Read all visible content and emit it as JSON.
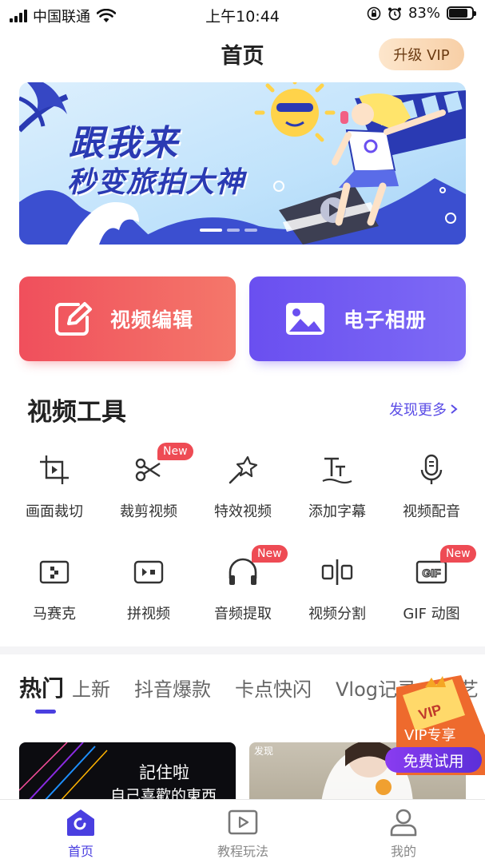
{
  "status_bar": {
    "carrier": "中国联通",
    "time": "上午10:44",
    "battery": "83%",
    "battery_level": 0.83
  },
  "header": {
    "title": "首页",
    "vip_button": "升级 VIP"
  },
  "banner": {
    "line1": "跟我来",
    "line2": "秒变旅拍大神"
  },
  "actions": {
    "edit_label": "视频编辑",
    "album_label": "电子相册"
  },
  "tools_section": {
    "title": "视频工具",
    "more": "发现更多",
    "badge": "New",
    "items": [
      {
        "label": "画面裁切",
        "icon": "crop-icon"
      },
      {
        "label": "裁剪视频",
        "icon": "scissors-icon",
        "badge": "New"
      },
      {
        "label": "特效视频",
        "icon": "magic-wand-icon"
      },
      {
        "label": "添加字幕",
        "icon": "subtitle-icon"
      },
      {
        "label": "视频配音",
        "icon": "microphone-icon"
      },
      {
        "label": "马赛克",
        "icon": "mosaic-icon"
      },
      {
        "label": "拼视频",
        "icon": "video-join-icon"
      },
      {
        "label": "音频提取",
        "icon": "headphones-icon",
        "badge": "New"
      },
      {
        "label": "视频分割",
        "icon": "split-icon"
      },
      {
        "label": "GIF 动图",
        "icon": "gif-icon",
        "badge": "New"
      }
    ]
  },
  "category_tabs": [
    "热门",
    "上新",
    "抖音爆款",
    "卡点快闪",
    "Vlog记录",
    "文艺"
  ],
  "thumbnails": {
    "first_line1": "記住啦",
    "first_line2": "自己喜歡的東西",
    "second_tag": "发现"
  },
  "vip_float": {
    "label": "VIP专享",
    "trial": "免费试用",
    "emblem": "VIP"
  },
  "tabbar": {
    "home": "首页",
    "tutorial": "教程玩法",
    "mine": "我的"
  },
  "colors": {
    "accent": "#4a3fe0",
    "edit_card": "#f04f5c",
    "album_card": "#6a4ff0",
    "badge": "#ee4b54"
  }
}
